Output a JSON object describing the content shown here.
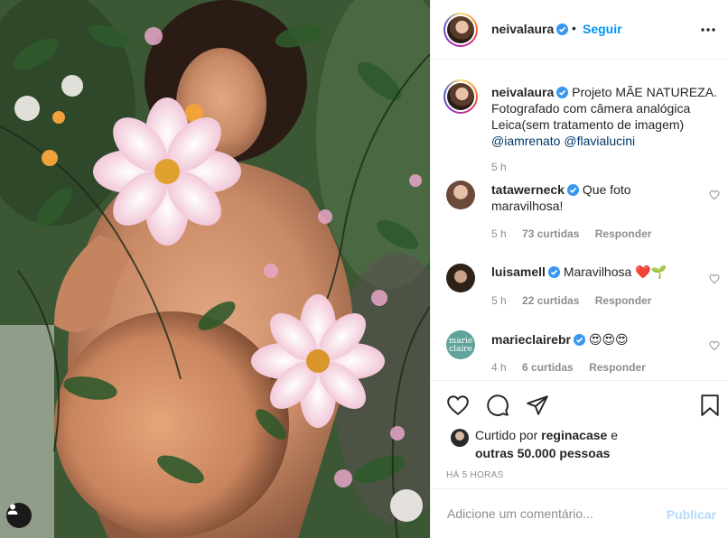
{
  "post": {
    "username": "neivalaura",
    "follow_label": "Seguir",
    "separator": "•"
  },
  "caption": {
    "username": "neivalaura",
    "line1": "Projeto MÃE NATUREZA.",
    "line2": "Fotografado com câmera analógica",
    "line3": "Leica(sem tratamento de imagem)",
    "mention1": "@iamrenato",
    "mention2": "@flavialucini",
    "time": "5 h"
  },
  "comments": [
    {
      "username": "tatawerneck",
      "text_line1": "Que foto",
      "text_line2": "maravilhosa!",
      "time": "5 h",
      "likes": "73 curtidas",
      "reply": "Responder"
    },
    {
      "username": "luisamell",
      "text_line1": "Maravilhosa ❤️🌱",
      "time": "5 h",
      "likes": "22 curtidas",
      "reply": "Responder"
    },
    {
      "username": "marieclairebr",
      "text_line1": "😍😍😍",
      "time": "4 h",
      "likes": "6 curtidas",
      "reply": "Responder",
      "avatar_text": "marie claire"
    }
  ],
  "likes": {
    "prefix": "Curtido por",
    "user": "reginacase",
    "conj": "e",
    "others": "outras 50.000 pessoas"
  },
  "timestamp": "HÁ 5 HORAS",
  "composer": {
    "placeholder": "Adicione um comentário...",
    "publish_label": "Publicar"
  },
  "colors": {
    "link": "#0095f6",
    "mention": "#00376b",
    "muted": "#8e8e8e",
    "publish_disabled": "#b3dbff",
    "verified": "#3897f0",
    "marieclaire_bg": "#5fa39a"
  },
  "icons": [
    "verified-icon",
    "more-options-icon",
    "heart-icon",
    "comment-icon",
    "share-icon",
    "save-icon",
    "tag-user-icon"
  ]
}
